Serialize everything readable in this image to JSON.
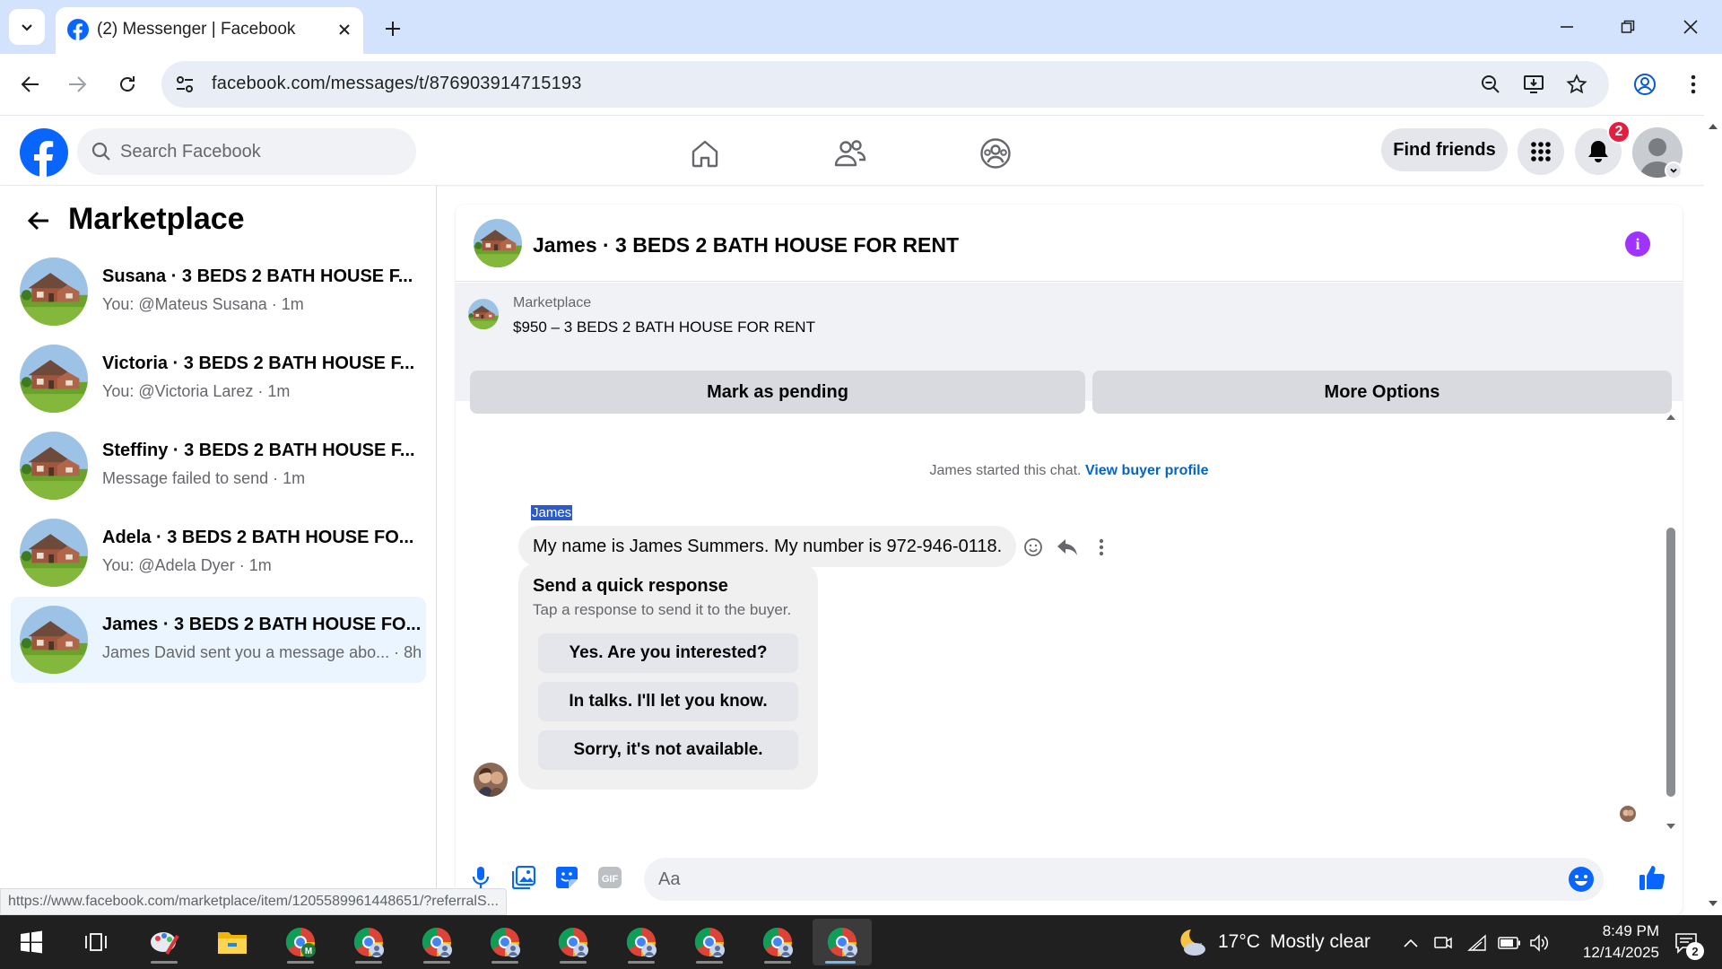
{
  "browser": {
    "tab_title": "(2) Messenger | Facebook",
    "url": "facebook.com/messages/t/876903914715193"
  },
  "header": {
    "search_placeholder": "Search Facebook",
    "find_friends": "Find friends",
    "notification_count": "2"
  },
  "sidebar": {
    "title": "Marketplace",
    "conversations": [
      {
        "name": "Susana · 3 BEDS 2 BATH HOUSE F...",
        "sub": "You: @Mateus Susana · 1m",
        "active": false
      },
      {
        "name": "Victoria · 3 BEDS 2 BATH HOUSE F...",
        "sub": "You: @Victoria Larez · 1m",
        "active": false
      },
      {
        "name": "Steffiny · 3 BEDS 2 BATH HOUSE F...",
        "sub": "Message failed to send · 1m",
        "active": false
      },
      {
        "name": "Adela · 3 BEDS 2 BATH HOUSE FO...",
        "sub": "You: @Adela Dyer · 1m",
        "active": false
      },
      {
        "name": "James · 3 BEDS 2 BATH HOUSE FO...",
        "sub": "James David sent you a message abo...  · 8h",
        "active": true
      }
    ]
  },
  "chat": {
    "title": "James · 3 BEDS 2 BATH HOUSE FOR RENT",
    "listing_category": "Marketplace",
    "listing_price": "$950 – 3 BEDS 2 BATH HOUSE FOR RENT",
    "mark_pending": "Mark as pending",
    "more_options": "More Options",
    "started_text": "James started this chat.",
    "view_profile": "View buyer profile",
    "sender_name": "James",
    "message": "My name is James Summers. My number is 972-946-0118.",
    "quick_title": "Send a quick response",
    "quick_sub": "Tap a response to send it to the buyer.",
    "quick_replies": [
      "Yes. Are you interested?",
      "In talks. I'll let you know.",
      "Sorry, it's not available."
    ],
    "input_placeholder": "Aa"
  },
  "status_url": "https://www.facebook.com/marketplace/item/1205589961448651/?referralS...",
  "taskbar": {
    "weather_temp": "17°C",
    "weather_desc": "Mostly clear",
    "time": "8:49 PM",
    "date": "12/14/2025",
    "notification_count": "2"
  },
  "colors": {
    "fb_blue": "#0866ff",
    "active_conv": "#ebf5ff",
    "info_purple": "#a033ff"
  }
}
